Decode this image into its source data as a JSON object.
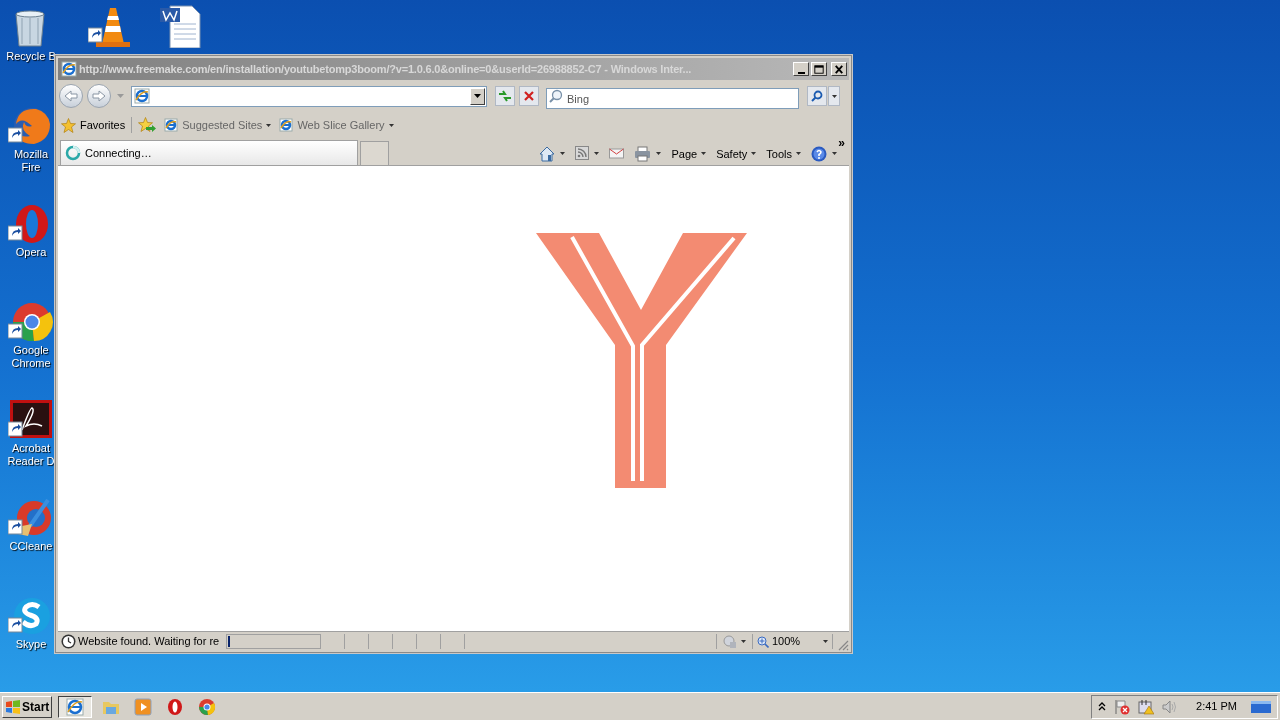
{
  "desktop_icons": [
    {
      "kind": "recycle",
      "label": "Recycle B"
    },
    {
      "kind": "firefox",
      "label": "Mozilla Fire"
    },
    {
      "kind": "opera",
      "label": "Opera"
    },
    {
      "kind": "chrome",
      "label": "Google\nChrome"
    },
    {
      "kind": "acrobat",
      "label": "Acrobat\nReader D"
    },
    {
      "kind": "ccleaner",
      "label": "CCleane"
    },
    {
      "kind": "skype",
      "label": "Skype"
    },
    {
      "kind": "vlc"
    },
    {
      "kind": "word"
    }
  ],
  "window": {
    "title": "http://www.freemake.com/en/installation/youtubetomp3boom/?v=1.0.6.0&online=0&userId=26988852-C7 - Windows Inter...",
    "search": {
      "placeholder": "Bing"
    },
    "favorites_bar": {
      "favorites": "Favorites",
      "items": [
        {
          "label": "Suggested Sites"
        },
        {
          "label": "Web Slice Gallery"
        }
      ]
    },
    "tabs": [
      {
        "label": "Connecting…",
        "selected": true
      }
    ],
    "command_bar": [
      {
        "kind": "home"
      },
      {
        "kind": "feed"
      },
      {
        "kind": "mail"
      },
      {
        "kind": "print"
      },
      {
        "kind": "menu",
        "label": "Page"
      },
      {
        "kind": "menu",
        "label": "Safety"
      },
      {
        "kind": "menu",
        "label": "Tools"
      },
      {
        "kind": "help"
      }
    ],
    "chevron": "»",
    "status_bar": {
      "text": "Website found. Waiting for re",
      "progress": {
        "level": 0.01
      },
      "zoom": "100%"
    }
  },
  "taskbar": {
    "start": "Start",
    "apps": [
      {
        "kind": "ie",
        "selected": true
      },
      {
        "kind": "explorer",
        "selected": false
      },
      {
        "kind": "media",
        "selected": false
      },
      {
        "kind": "opera",
        "selected": false
      },
      {
        "kind": "chrome",
        "selected": false
      }
    ],
    "clock": "2:41 PM"
  }
}
